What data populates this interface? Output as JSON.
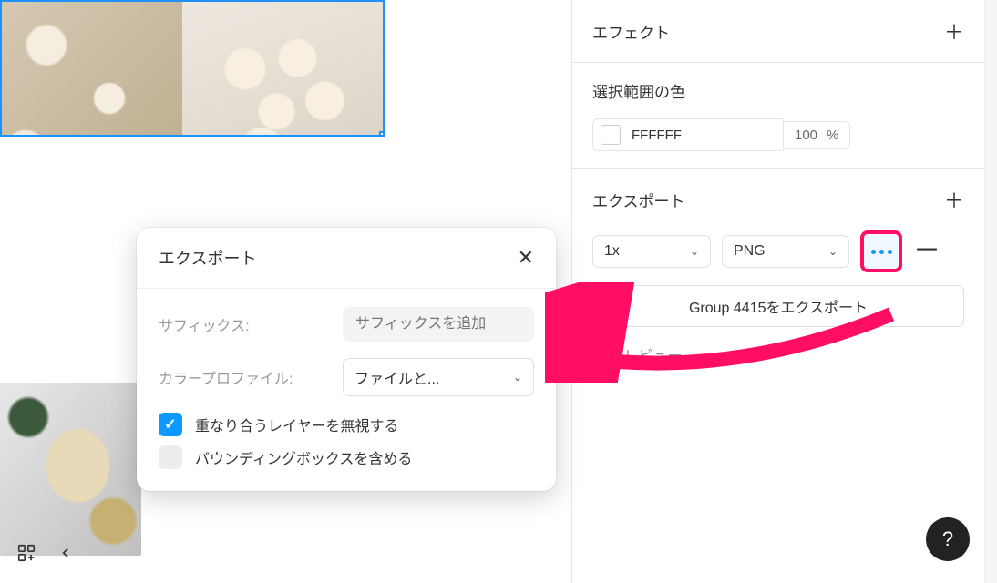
{
  "sidebar": {
    "effects_label": "エフェクト",
    "selection_colors_label": "選択範囲の色",
    "color_hex": "FFFFFF",
    "color_opacity": "100",
    "color_unit": "%",
    "export_label": "エクスポート",
    "scale_value": "1x",
    "format_value": "PNG",
    "export_button_label": "Group 4415をエクスポート",
    "preview_label": "プレビュー"
  },
  "popover": {
    "title": "エクスポート",
    "suffix_label": "サフィックス:",
    "suffix_placeholder": "サフィックスを追加",
    "color_profile_label": "カラープロファイル:",
    "color_profile_value": "ファイルと...",
    "ignore_overlap_label": "重なり合うレイヤーを無視する",
    "include_bounding_label": "バウンディングボックスを含める",
    "ignore_overlap_checked": true,
    "include_bounding_checked": false
  },
  "help_label": "?",
  "annotation": {
    "arrow_color": "#FF0E63"
  }
}
